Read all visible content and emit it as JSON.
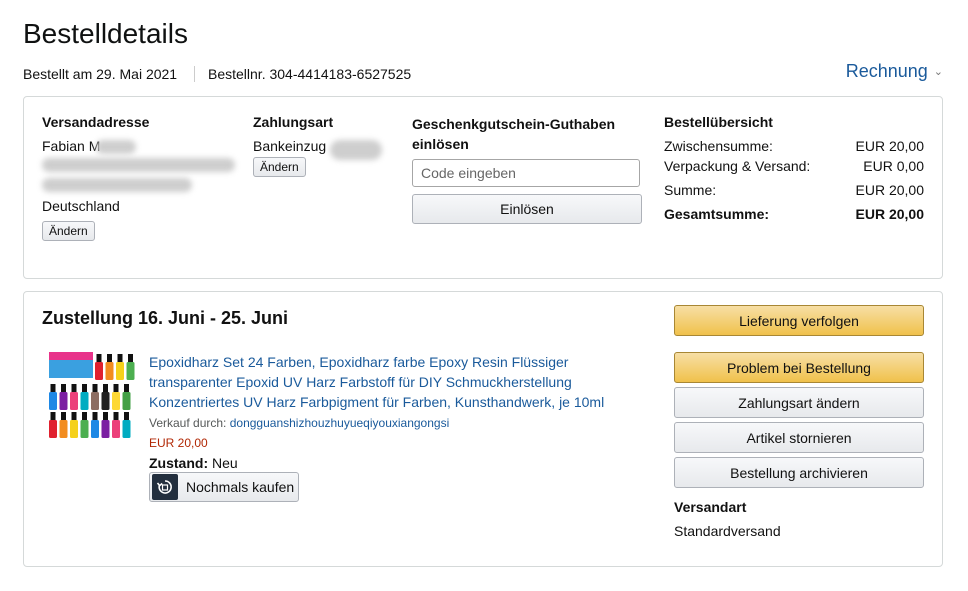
{
  "page": {
    "title": "Bestelldetails"
  },
  "order": {
    "ordered_on": "Bestellt am 29. Mai 2021",
    "order_number": "Bestellnr. 304-4414183-6527525",
    "invoice_label": "Rechnung"
  },
  "summary_box": {
    "shipping_address": {
      "header": "Versandadresse",
      "name_visible": "Fabian M",
      "country": "Deutschland",
      "change_label": "Ändern"
    },
    "payment": {
      "header": "Zahlungsart",
      "method_visible": "Bankeinzug",
      "change_label": "Ändern"
    },
    "gift_card": {
      "header": "Geschenkgutschein-Guthaben einlösen",
      "placeholder": "Code eingeben",
      "redeem_label": "Einlösen"
    },
    "order_summary": {
      "header": "Bestellübersicht",
      "rows": [
        {
          "label": "Zwischensumme:",
          "value": "EUR 20,00"
        },
        {
          "label": "Verpackung & Versand:",
          "value": "EUR 0,00"
        },
        {
          "label": "Summe:",
          "value": "EUR 20,00"
        },
        {
          "label": "Gesamtsumme:",
          "value": "EUR 20,00"
        }
      ]
    }
  },
  "shipment": {
    "delivery_window": "Zustellung 16. Juni - 25. Juni",
    "product": {
      "title": "Epoxidharz Set 24 Farben, Epoxidharz farbe Epoxy Resin Flüssiger transparenter Epoxid UV Harz Farbstoff für DIY Schmuckherstellung Konzentriertes UV Harz Farbpigment für Farben, Kunsthandwerk, je 10ml",
      "sold_by_label": "Verkauf durch:",
      "seller": "dongguanshizhouzhuyueqiyouxiangongsi",
      "price": "EUR 20,00",
      "condition_label": "Zustand:",
      "condition_value": "Neu",
      "buy_again_label": "Nochmals kaufen"
    },
    "actions": {
      "track": "Lieferung verfolgen",
      "problem": "Problem bei Bestellung",
      "change_payment": "Zahlungsart ändern",
      "cancel_items": "Artikel stornieren",
      "archive": "Bestellung archivieren"
    },
    "shipping_method": {
      "header": "Versandart",
      "value": "Standardversand"
    }
  },
  "colors": {
    "link": "#1a5a9b",
    "price": "#b12704",
    "primary_button": "#f0c14b",
    "border": "#d5d9d9"
  }
}
